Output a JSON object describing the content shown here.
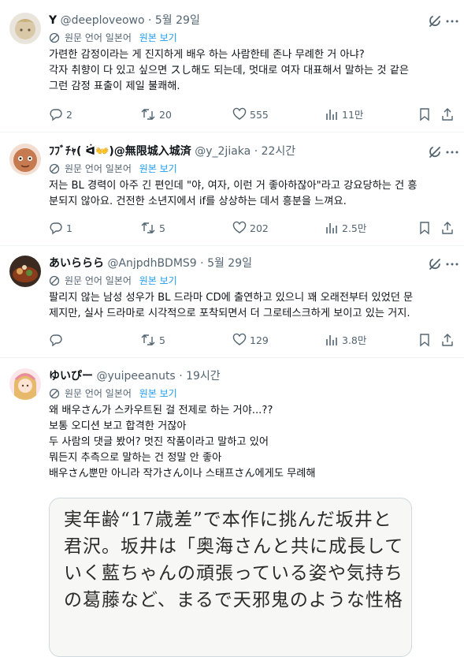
{
  "translation": {
    "label": "원문 언어 일본어",
    "show_original": "원본 보기"
  },
  "tweets": [
    {
      "name": "Y",
      "handle": "@deeploveowo",
      "dot": "·",
      "time": "5월 29일",
      "lines": [
        "가련한 감정이라는 게 진지하게 배우 하는 사람한테 존나 무례한 거 아냐?",
        "각자 취향이 다 있고 싶으면 スし해도 되는데, 멋대로 여자 대표해서 말하는 것 같은",
        "그런 감정 표출이 제일 불쾌해."
      ],
      "replies": "2",
      "reposts": "20",
      "likes": "555",
      "views": "11만"
    },
    {
      "name": "ﾌﾌﾞﾁｬ( ᐛ👐)@無限城入城済",
      "handle": "@y_2jiaka",
      "dot": "·",
      "time": "22시간",
      "lines": [
        "저는 BL 경력이 아주 긴 편인데 \"야, 여자, 이런 거 좋아하잖아\"라고 강요당하는 건 흥",
        "분되지 않아요. 건전한 소년지에서 if를 상상하는 데서 흥분을 느껴요."
      ],
      "replies": "1",
      "reposts": "5",
      "likes": "202",
      "views": "2.5만"
    },
    {
      "name": "あいららら",
      "handle": "@AnjpdhBDMS9",
      "dot": "·",
      "time": "5월 29일",
      "lines": [
        "팔리지 않는 남성 성우가 BL 드라마 CD에 출연하고 있으니 꽤 오래전부터 있었던 문",
        "제지만, 실사 드라마로 시각적으로 포착되면서 더 그로테스크하게 보이고 있는 거지."
      ],
      "replies": "",
      "reposts": "5",
      "likes": "129",
      "views": "3.8만"
    },
    {
      "name": "ゆいぴー",
      "handle": "@yuipeeanuts",
      "dot": "·",
      "time": "19시간",
      "lines": [
        "왜 배우さん가 스카우트된 걸 전제로 하는 거야...??",
        "보통 오디션 보고 합격한 거잖아",
        "두 사람의 댓글 봤어? 멋진 작품이라고 말하고 있어",
        "뭐든지 추측으로 말하는 건 정말 안 좋아",
        "배우さん뿐만 아니라 작가さん이나 스태프さん에게도 무례해"
      ],
      "card_lines": [
        "実年齢“17歳差”で本作に挑んだ坂井と",
        "君沢。坂井は「奥海さんと共に成長して",
        "いく藍ちゃんの頑張っている姿や気持ち",
        "の葛藤など、まるで天邪鬼のような性格"
      ]
    }
  ]
}
